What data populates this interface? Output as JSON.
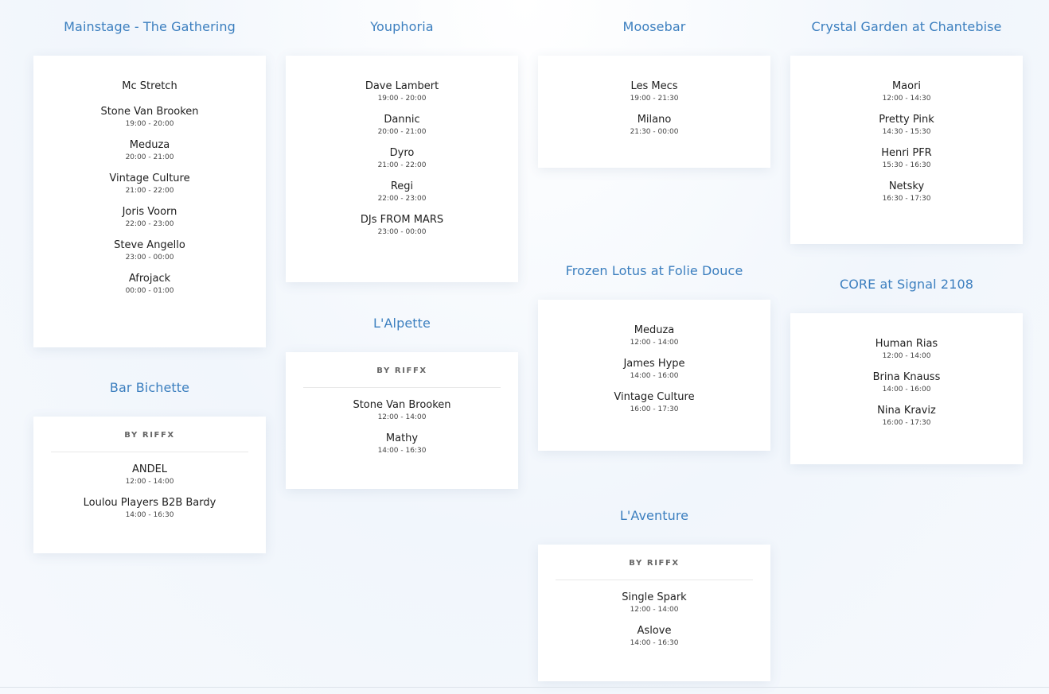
{
  "stages": {
    "mainstage": {
      "title": "Mainstage - The Gathering",
      "acts": [
        {
          "name": "Mc Stretch",
          "time": ""
        },
        {
          "name": "Stone Van Brooken",
          "time": "19:00 - 20:00"
        },
        {
          "name": "Meduza",
          "time": "20:00 - 21:00"
        },
        {
          "name": "Vintage Culture",
          "time": "21:00 - 22:00"
        },
        {
          "name": "Joris Voorn",
          "time": "22:00 - 23:00"
        },
        {
          "name": "Steve Angello",
          "time": "23:00 - 00:00"
        },
        {
          "name": "Afrojack",
          "time": "00:00 - 01:00"
        }
      ]
    },
    "bar_bichette": {
      "title": "Bar Bichette",
      "by": "BY RIFFX",
      "acts": [
        {
          "name": "ANDEL",
          "time": "12:00 - 14:00"
        },
        {
          "name": "Loulou Players B2B Bardy",
          "time": "14:00 - 16:30"
        }
      ]
    },
    "youphoria": {
      "title": "Youphoria",
      "acts": [
        {
          "name": "Dave Lambert",
          "time": "19:00 - 20:00"
        },
        {
          "name": "Dannic",
          "time": "20:00 - 21:00"
        },
        {
          "name": "Dyro",
          "time": "21:00 - 22:00"
        },
        {
          "name": "Regi",
          "time": "22:00 - 23:00"
        },
        {
          "name": "DJs FROM MARS",
          "time": "23:00 - 00:00"
        }
      ]
    },
    "lalpette": {
      "title": "L'Alpette",
      "by": "BY RIFFX",
      "acts": [
        {
          "name": "Stone Van Brooken",
          "time": "12:00 - 14:00"
        },
        {
          "name": "Mathy",
          "time": "14:00 - 16:30"
        }
      ]
    },
    "moosebar": {
      "title": "Moosebar",
      "acts": [
        {
          "name": "Les Mecs",
          "time": "19:00 - 21:30"
        },
        {
          "name": "Milano",
          "time": "21:30 - 00:00"
        }
      ]
    },
    "frozen_lotus": {
      "title": "Frozen Lotus at Folie Douce",
      "acts": [
        {
          "name": "Meduza",
          "time": "12:00 - 14:00"
        },
        {
          "name": "James Hype",
          "time": "14:00 - 16:00"
        },
        {
          "name": "Vintage Culture",
          "time": "16:00 - 17:30"
        }
      ]
    },
    "laventure": {
      "title": "L'Aventure",
      "by": "BY RIFFX",
      "acts": [
        {
          "name": "Single Spark",
          "time": "12:00 - 14:00"
        },
        {
          "name": "Aslove",
          "time": "14:00 - 16:30"
        }
      ]
    },
    "crystal_garden": {
      "title": "Crystal Garden at Chantebise",
      "acts": [
        {
          "name": "Maori",
          "time": "12:00 - 14:30"
        },
        {
          "name": "Pretty Pink",
          "time": "14:30 - 15:30"
        },
        {
          "name": "Henri PFR",
          "time": "15:30 - 16:30"
        },
        {
          "name": "Netsky",
          "time": "16:30 - 17:30"
        }
      ]
    },
    "core_signal": {
      "title": "CORE at Signal 2108",
      "acts": [
        {
          "name": "Human Rias",
          "time": "12:00 - 14:00"
        },
        {
          "name": "Brina Knauss",
          "time": "14:00 - 16:00"
        },
        {
          "name": "Nina Kraviz",
          "time": "16:00 - 17:30"
        }
      ]
    }
  },
  "colors": {
    "stage_title": "#3c7fbf",
    "background": "#f3f7fc",
    "card": "#ffffff"
  }
}
